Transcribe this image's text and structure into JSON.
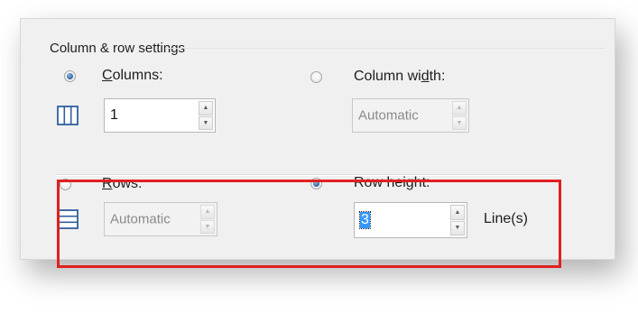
{
  "group": {
    "title": "Column & row settings"
  },
  "columns": {
    "label_first": "C",
    "label_rest": "olumns:",
    "selected": true,
    "value": "1",
    "icon": "columns-icon"
  },
  "column_width": {
    "label_pre": "Column wi",
    "label_ul": "d",
    "label_post": "th:",
    "selected": false,
    "value": "Automatic"
  },
  "rows": {
    "label_first": "R",
    "label_rest": "ows:",
    "selected": false,
    "value": "Automatic",
    "icon": "rows-icon"
  },
  "row_height": {
    "label": "Row height:",
    "selected": true,
    "value": "3",
    "unit": "Line(s)"
  },
  "colors": {
    "highlight": "#e02020",
    "radio_dot": "#3568a6"
  }
}
